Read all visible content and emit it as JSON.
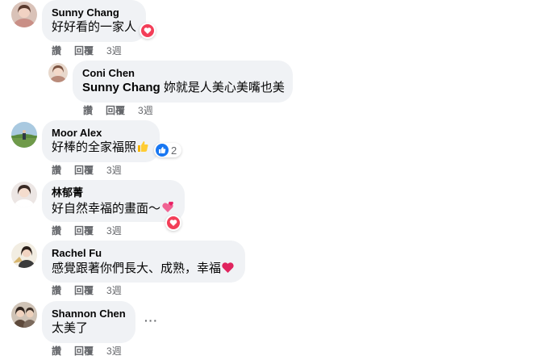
{
  "comments": [
    {
      "author": "Sunny Chang",
      "text": "好好看的一家人",
      "reaction": "love",
      "actions": {
        "like": "讚",
        "reply": "回覆",
        "time": "3週"
      }
    },
    {
      "author": "Coni Chen",
      "mention": "Sunny Chang",
      "text": " 妳就是人美心美嘴也美",
      "actions": {
        "like": "讚",
        "reply": "回覆",
        "time": "3週"
      }
    },
    {
      "author": "Moor Alex",
      "text": "好棒的全家福照",
      "emoji": "thumbs-up",
      "reaction": "like",
      "reaction_count": "2",
      "actions": {
        "like": "讚",
        "reply": "回覆",
        "time": "3週"
      }
    },
    {
      "author": "林郁菁",
      "text": "好自然幸福的畫面～",
      "emoji": "two-hearts",
      "reaction": "love",
      "actions": {
        "like": "讚",
        "reply": "回覆",
        "time": "3週"
      }
    },
    {
      "author": "Rachel Fu",
      "text": "感覺跟著你們長大、成熟，幸福",
      "emoji": "red-heart",
      "actions": {
        "like": "讚",
        "reply": "回覆",
        "time": "3週"
      }
    },
    {
      "author": "Shannon Chen",
      "text": "太美了",
      "more": "···",
      "actions": {
        "like": "讚",
        "reply": "回覆",
        "time": "3週"
      }
    }
  ],
  "colors": {
    "bubble": "#f0f2f5",
    "secondary_text": "#65676b",
    "love": "#f33e58",
    "like": "#1877f2"
  }
}
